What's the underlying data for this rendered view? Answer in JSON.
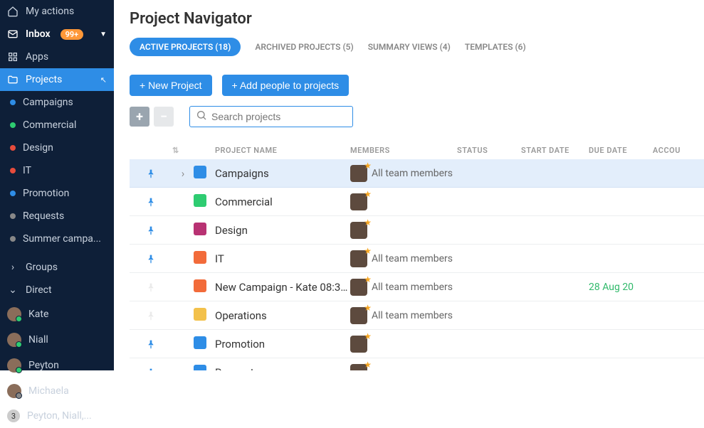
{
  "sidebar": {
    "top": [
      {
        "icon": "home",
        "label": "My actions",
        "badge": null
      },
      {
        "icon": "mail",
        "label": "Inbox",
        "badge": "99+",
        "bold": true,
        "chev": true
      },
      {
        "icon": "grid",
        "label": "Apps",
        "badge": null
      }
    ],
    "projects": {
      "label": "Projects",
      "items": [
        {
          "color": "#2e8de6",
          "label": "Campaigns"
        },
        {
          "color": "#2ecc71",
          "label": "Commercial"
        },
        {
          "color": "#e74c3c",
          "label": "Design"
        },
        {
          "color": "#e74c3c",
          "label": "IT"
        },
        {
          "color": "#2e8de6",
          "label": "Promotion"
        },
        {
          "color": "#888",
          "label": "Requests"
        },
        {
          "color": "#888",
          "label": "Summer campa..."
        }
      ]
    },
    "groups_label": "Groups",
    "direct_label": "Direct",
    "direct": [
      {
        "label": "Kate",
        "online": true
      },
      {
        "label": "Niall",
        "online": true
      },
      {
        "label": "Peyton",
        "online": true
      },
      {
        "label": "Michaela",
        "online": false
      },
      {
        "label": "Peyton, Niall,...",
        "count": "3"
      }
    ]
  },
  "page": {
    "title": "Project Navigator",
    "tabs": [
      {
        "label": "ACTIVE PROJECTS (18)",
        "active": true
      },
      {
        "label": "ARCHIVED PROJECTS (5)"
      },
      {
        "label": "SUMMARY VIEWS (4)"
      },
      {
        "label": "TEMPLATES (6)"
      }
    ],
    "buttons": {
      "new_project": "+ New Project",
      "add_people": "+ Add people to projects"
    },
    "search_placeholder": "Search projects",
    "columns": {
      "name": "PROJECT NAME",
      "members": "MEMBERS",
      "status": "STATUS",
      "start": "START DATE",
      "due": "DUE DATE",
      "acc": "ACCOU"
    },
    "rows": [
      {
        "pinned": true,
        "exp": true,
        "color": "#2e8de6",
        "name": "Campaigns",
        "members": "All team members",
        "due": "",
        "selected": true
      },
      {
        "pinned": true,
        "color": "#2ecc71",
        "name": "Commercial",
        "members": "",
        "due": ""
      },
      {
        "pinned": true,
        "color": "#b83273",
        "name": "Design",
        "members": "",
        "due": ""
      },
      {
        "pinned": true,
        "color": "#f26b3a",
        "name": "IT",
        "members": "All team members",
        "due": ""
      },
      {
        "pinned": false,
        "color": "#f26b3a",
        "name": "New Campaign - Kate 08:30...",
        "members": "All team members",
        "due": "28 Aug 20"
      },
      {
        "pinned": false,
        "color": "#f3c14b",
        "name": "Operations",
        "members": "All team members",
        "due": ""
      },
      {
        "pinned": true,
        "color": "#2e8de6",
        "name": "Promotion",
        "members": "",
        "due": ""
      },
      {
        "pinned": true,
        "color": "#2e8de6",
        "name": "Requests",
        "members": "",
        "due": ""
      }
    ]
  }
}
